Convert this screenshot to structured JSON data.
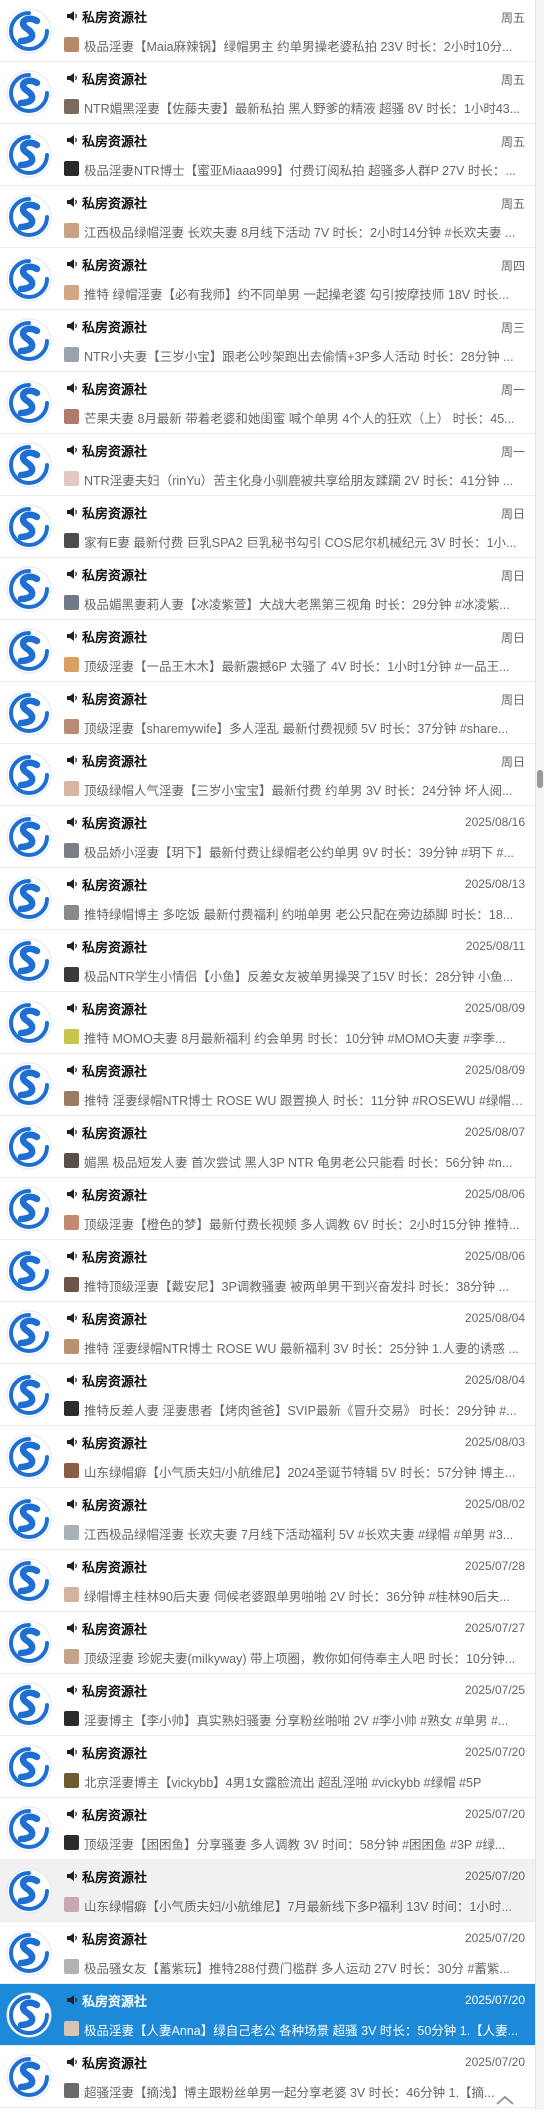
{
  "colors": {
    "accent": "#1c8ad8",
    "logo": "#1e6fd1",
    "selected_row": "#1c8ad8",
    "text_secondary": "#666666"
  },
  "icons": {
    "avatar": "s-logo-icon",
    "sender_prefix": "speaker-icon",
    "back_to_top": "chevron-up-icon"
  },
  "selected_index": 32,
  "messages": [
    {
      "sender": "私房资源社",
      "date": "周五",
      "preview": "极品淫妻【Maia麻辣锅】绿帽男主 约单男操老婆私拍 23V 时长：2小时10分...",
      "thumb": "#b98a6a"
    },
    {
      "sender": "私房资源社",
      "date": "周五",
      "preview": "NTR媚黑淫妻【佐藤夫妻】最新私拍 黑人野爹的精液 超骚 8V 时长：1小时43...",
      "thumb": "#7b6b5e"
    },
    {
      "sender": "私房资源社",
      "date": "周五",
      "preview": "极品淫妻NTR博士【蜜亚Miaaa999】付费订阅私拍 超骚多人群P 27V 时长：...",
      "thumb": "#2a2a2a"
    },
    {
      "sender": "私房资源社",
      "date": "周五",
      "preview": "江西极品绿帽淫妻 长欢夫妻 8月线下活动 7V 时长：2小时14分钟 #长欢夫妻 ...",
      "thumb": "#c9a184"
    },
    {
      "sender": "私房资源社",
      "date": "周四",
      "preview": "推特 绿帽淫妻【必有我师】约不同单男 一起操老婆 勾引按摩技师 18V 时长...",
      "thumb": "#d4a582"
    },
    {
      "sender": "私房资源社",
      "date": "周三",
      "preview": "NTR小夫妻【三岁小宝】跟老公吵架跑出去偷情+3P多人活动 时长：28分钟 ...",
      "thumb": "#9aa3ad"
    },
    {
      "sender": "私房资源社",
      "date": "周一",
      "preview": "芒果夫妻 8月最新 带着老婆和她闺蜜 喊个单男 4个人的狂欢（上） 时长：45...",
      "thumb": "#b27a6a"
    },
    {
      "sender": "私房资源社",
      "date": "周一",
      "preview": "NTR淫妻夫妇（rinYu）苦主化身小驯鹿被共享给朋友蹂躏 2V 时长：41分钟 ...",
      "thumb": "#e2c7c2"
    },
    {
      "sender": "私房资源社",
      "date": "周日",
      "preview": "家有E妻 最新付费 巨乳SPA2 巨乳秘书勾引 COS尼尔机械纪元 3V 时长：1小...",
      "thumb": "#4d4d4d"
    },
    {
      "sender": "私房资源社",
      "date": "周日",
      "preview": "极品媚黑妻莉人妻【冰凌紫萱】大战大老黑第三视角 时长：29分钟 #冰凌紫...",
      "thumb": "#6f7a86"
    },
    {
      "sender": "私房资源社",
      "date": "周日",
      "preview": "顶级淫妻【一品王木木】最新震撼6P 太骚了 4V 时长：1小时1分钟 #一品王...",
      "thumb": "#d9a066"
    },
    {
      "sender": "私房资源社",
      "date": "周日",
      "preview": "顶级淫妻【sharemywife】多人淫乱 最新付费视频 5V 时长：37分钟 #share...",
      "thumb": "#b98c73"
    },
    {
      "sender": "私房资源社",
      "date": "周日",
      "preview": "顶级绿帽人气淫妻【三岁小宝宝】最新付费 约单男 3V 时长：24分钟 坏人阅...",
      "thumb": "#d8b5a2"
    },
    {
      "sender": "私房资源社",
      "date": "2025/08/16",
      "preview": "极品娇小淫妻【玥下】最新付费让绿帽老公约单男 9V 时长：39分钟 #玥下 #...",
      "thumb": "#7a7f86"
    },
    {
      "sender": "私房资源社",
      "date": "2025/08/13",
      "preview": "推特绿帽博主 多吃饭 最新付费福利 约啪单男 老公只配在旁边舔脚 时长：18...",
      "thumb": "#8a8a8a"
    },
    {
      "sender": "私房资源社",
      "date": "2025/08/11",
      "preview": "极品NTR学生小情侣【小鱼】反差女友被单男操哭了15V 时长：28分钟 小鱼...",
      "thumb": "#3a3a3a"
    },
    {
      "sender": "私房资源社",
      "date": "2025/08/09",
      "preview": "推特 MOMO夫妻 8月最新福利 约会单男 时长：10分钟 #MOMO夫妻 #李季...",
      "thumb": "#c7c54a"
    },
    {
      "sender": "私房资源社",
      "date": "2025/08/09",
      "preview": "推特 淫妻绿帽NTR博士 ROSE WU 跟置换人 时长：11分钟 #ROSEWU #绿帽 ...",
      "thumb": "#9c7b62"
    },
    {
      "sender": "私房资源社",
      "date": "2025/08/07",
      "preview": "媚黑 极品短发人妻 首次尝试 黑人3P NTR 龟男老公只能看 时长：56分钟 #n...",
      "thumb": "#5a4f48"
    },
    {
      "sender": "私房资源社",
      "date": "2025/08/06",
      "preview": "顶级淫妻【橙色的梦】最新付费长视频 多人调教 6V 时长：2小时15分钟 推特...",
      "thumb": "#c48a6f"
    },
    {
      "sender": "私房资源社",
      "date": "2025/08/06",
      "preview": "推特顶级淫妻【戴安尼】3P调教骚妻 被两单男干到兴奋发抖 时长：38分钟 ...",
      "thumb": "#6b5448"
    },
    {
      "sender": "私房资源社",
      "date": "2025/08/04",
      "preview": "推特 淫妻绿帽NTR博士 ROSE WU 最新福利 3V 时长：25分钟 1.人妻的诱惑 ...",
      "thumb": "#b9926f"
    },
    {
      "sender": "私房资源社",
      "date": "2025/08/04",
      "preview": "推特反差人妻 淫妻患者【烤肉爸爸】SVIP最新《冒升交易》 时长：29分钟 #...",
      "thumb": "#2d2d2d"
    },
    {
      "sender": "私房资源社",
      "date": "2025/08/03",
      "preview": "山东绿帽癖【小气质夫妇/小航维尼】2024圣诞节特辑 5V 时长：57分钟 博主...",
      "thumb": "#8a5c44"
    },
    {
      "sender": "私房资源社",
      "date": "2025/08/02",
      "preview": "江西极品绿帽淫妻 长欢夫妻 7月线下活动福利 5V #长欢夫妻 #绿帽 #单男 #3...",
      "thumb": "#a8b0b8"
    },
    {
      "sender": "私房资源社",
      "date": "2025/07/28",
      "preview": "绿帽博主桂林90后夫妻 伺候老婆跟单男啪啪 2V 时长：36分钟 #桂林90后夫...",
      "thumb": "#d2b3a0"
    },
    {
      "sender": "私房资源社",
      "date": "2025/07/27",
      "preview": "顶级淫妻 珍妮夫妻(milkyway) 带上项圈，教你如何侍奉主人吧 时长：10分钟...",
      "thumb": "#c4a38c"
    },
    {
      "sender": "私房资源社",
      "date": "2025/07/25",
      "preview": "淫妻博主【李小帅】真实熟妇骚妻 分享粉丝啪啪 2V #李小帅 #熟女 #单男 #...",
      "thumb": "#2a2a2a"
    },
    {
      "sender": "私房资源社",
      "date": "2025/07/20",
      "preview": "北京淫妻博主【vickybb】4男1女露脸流出 超乱淫啪 #vickybb #绿帽 #5P",
      "thumb": "#6e5a2c"
    },
    {
      "sender": "私房资源社",
      "date": "2025/07/20",
      "preview": "顶级淫妻【困困鱼】分享骚妻 多人调教 3V 时间：58分钟 #困困鱼 #3P #绿...",
      "thumb": "#2b2b2b"
    },
    {
      "sender": "私房资源社",
      "date": "2025/07/20",
      "preview": "山东绿帽癖【小气质夫妇/小航维尼】7月最新线下多P福利 13V 时间：1小时...",
      "thumb": "#c9a9b0"
    },
    {
      "sender": "私房资源社",
      "date": "2025/07/20",
      "preview": "极品骚女友【蓄紫玩】推特288付费门槛群 多人运动 27V 时长：30分 #蓄紫...",
      "thumb": "#b4b2ae"
    },
    {
      "sender": "私房资源社",
      "date": "2025/07/20",
      "preview": "极品淫妻【人妻Anna】绿自己老公 各种场景 超骚 3V 时长：50分钟 1.【人妻...",
      "thumb": "#d8c3b5"
    },
    {
      "sender": "私房资源社",
      "date": "2025/07/20",
      "preview": "超骚淫妻【摘浅】博主跟粉丝单男一起分享老婆 3V 时长：46分钟 1.【摘...",
      "thumb": "#6a6a6a"
    }
  ]
}
